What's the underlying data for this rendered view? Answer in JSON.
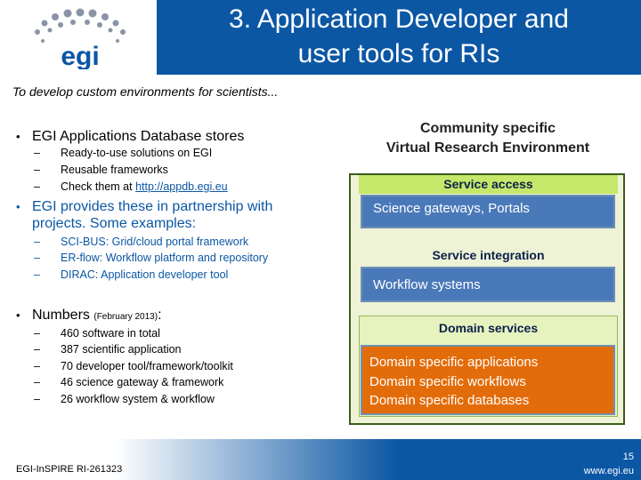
{
  "header": {
    "logo_text": "egi",
    "title_line1": "3. Application Developer and",
    "title_line2": "user tools for RIs"
  },
  "intro": "To develop custom environments for scientists...",
  "left": {
    "bullet1": {
      "text": "EGI Applications Database stores",
      "subs": [
        "Ready-to-use solutions on EGI",
        "Reusable frameworks"
      ],
      "link_prefix": "Check them at ",
      "link": "http://appdb.egi.eu"
    },
    "bullet2": {
      "text": "EGI provides these in partnership with projects. Some examples:",
      "subs": [
        "SCI-BUS: Grid/cloud portal framework",
        "ER-flow: Workflow platform and repository",
        "DIRAC: Application developer tool"
      ]
    },
    "bullet3": {
      "text": "Numbers",
      "note": "(February 2013)",
      "colon": ":",
      "subs": [
        "460 software in total",
        "387 scientific application",
        "70 developer tool/framework/toolkit",
        "46 science gateway & framework",
        "26 workflow system & workflow"
      ]
    }
  },
  "diagram": {
    "title_line1": "Community specific",
    "title_line2": "Virtual Research Environment",
    "service_access": "Service access",
    "gateways": "Science gateways, Portals",
    "service_integration": "Service integration",
    "workflow": "Workflow systems",
    "domain_services": "Domain services",
    "domain_items": [
      "Domain specific applications",
      "Domain specific workflows",
      "Domain specific databases"
    ]
  },
  "footer": {
    "project": "EGI-InSPIRE RI-261323",
    "page": "15",
    "site": "www.egi.eu"
  },
  "colors": {
    "brand_blue": "#0b57a4",
    "panel_green": "#eef3d6",
    "bar_green": "#c6e86a",
    "box_blue": "#4a79b9",
    "box_orange": "#e36c0a"
  }
}
